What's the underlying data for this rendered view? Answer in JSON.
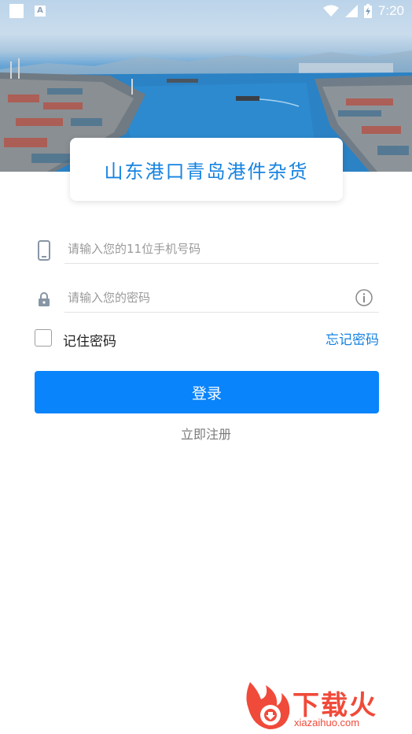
{
  "status_bar": {
    "time": "7:20",
    "icons": [
      "notification-square-icon",
      "a-translate-icon",
      "wifi-icon",
      "signal-icon",
      "battery-charging-icon"
    ]
  },
  "header": {
    "title": "山东港口青岛港件杂货"
  },
  "form": {
    "phone_placeholder": "请输入您的11位手机号码",
    "password_placeholder": "请输入您的密码",
    "remember_label": "记住密码",
    "forgot_label": "忘记密码",
    "login_label": "登录",
    "register_label": "立即注册"
  },
  "watermark": {
    "main": "下载火",
    "sub": "xiazaihuo.com"
  },
  "colors": {
    "accent": "#1683e0",
    "button": "#0a84fa",
    "watermark": "#f04a3a"
  }
}
